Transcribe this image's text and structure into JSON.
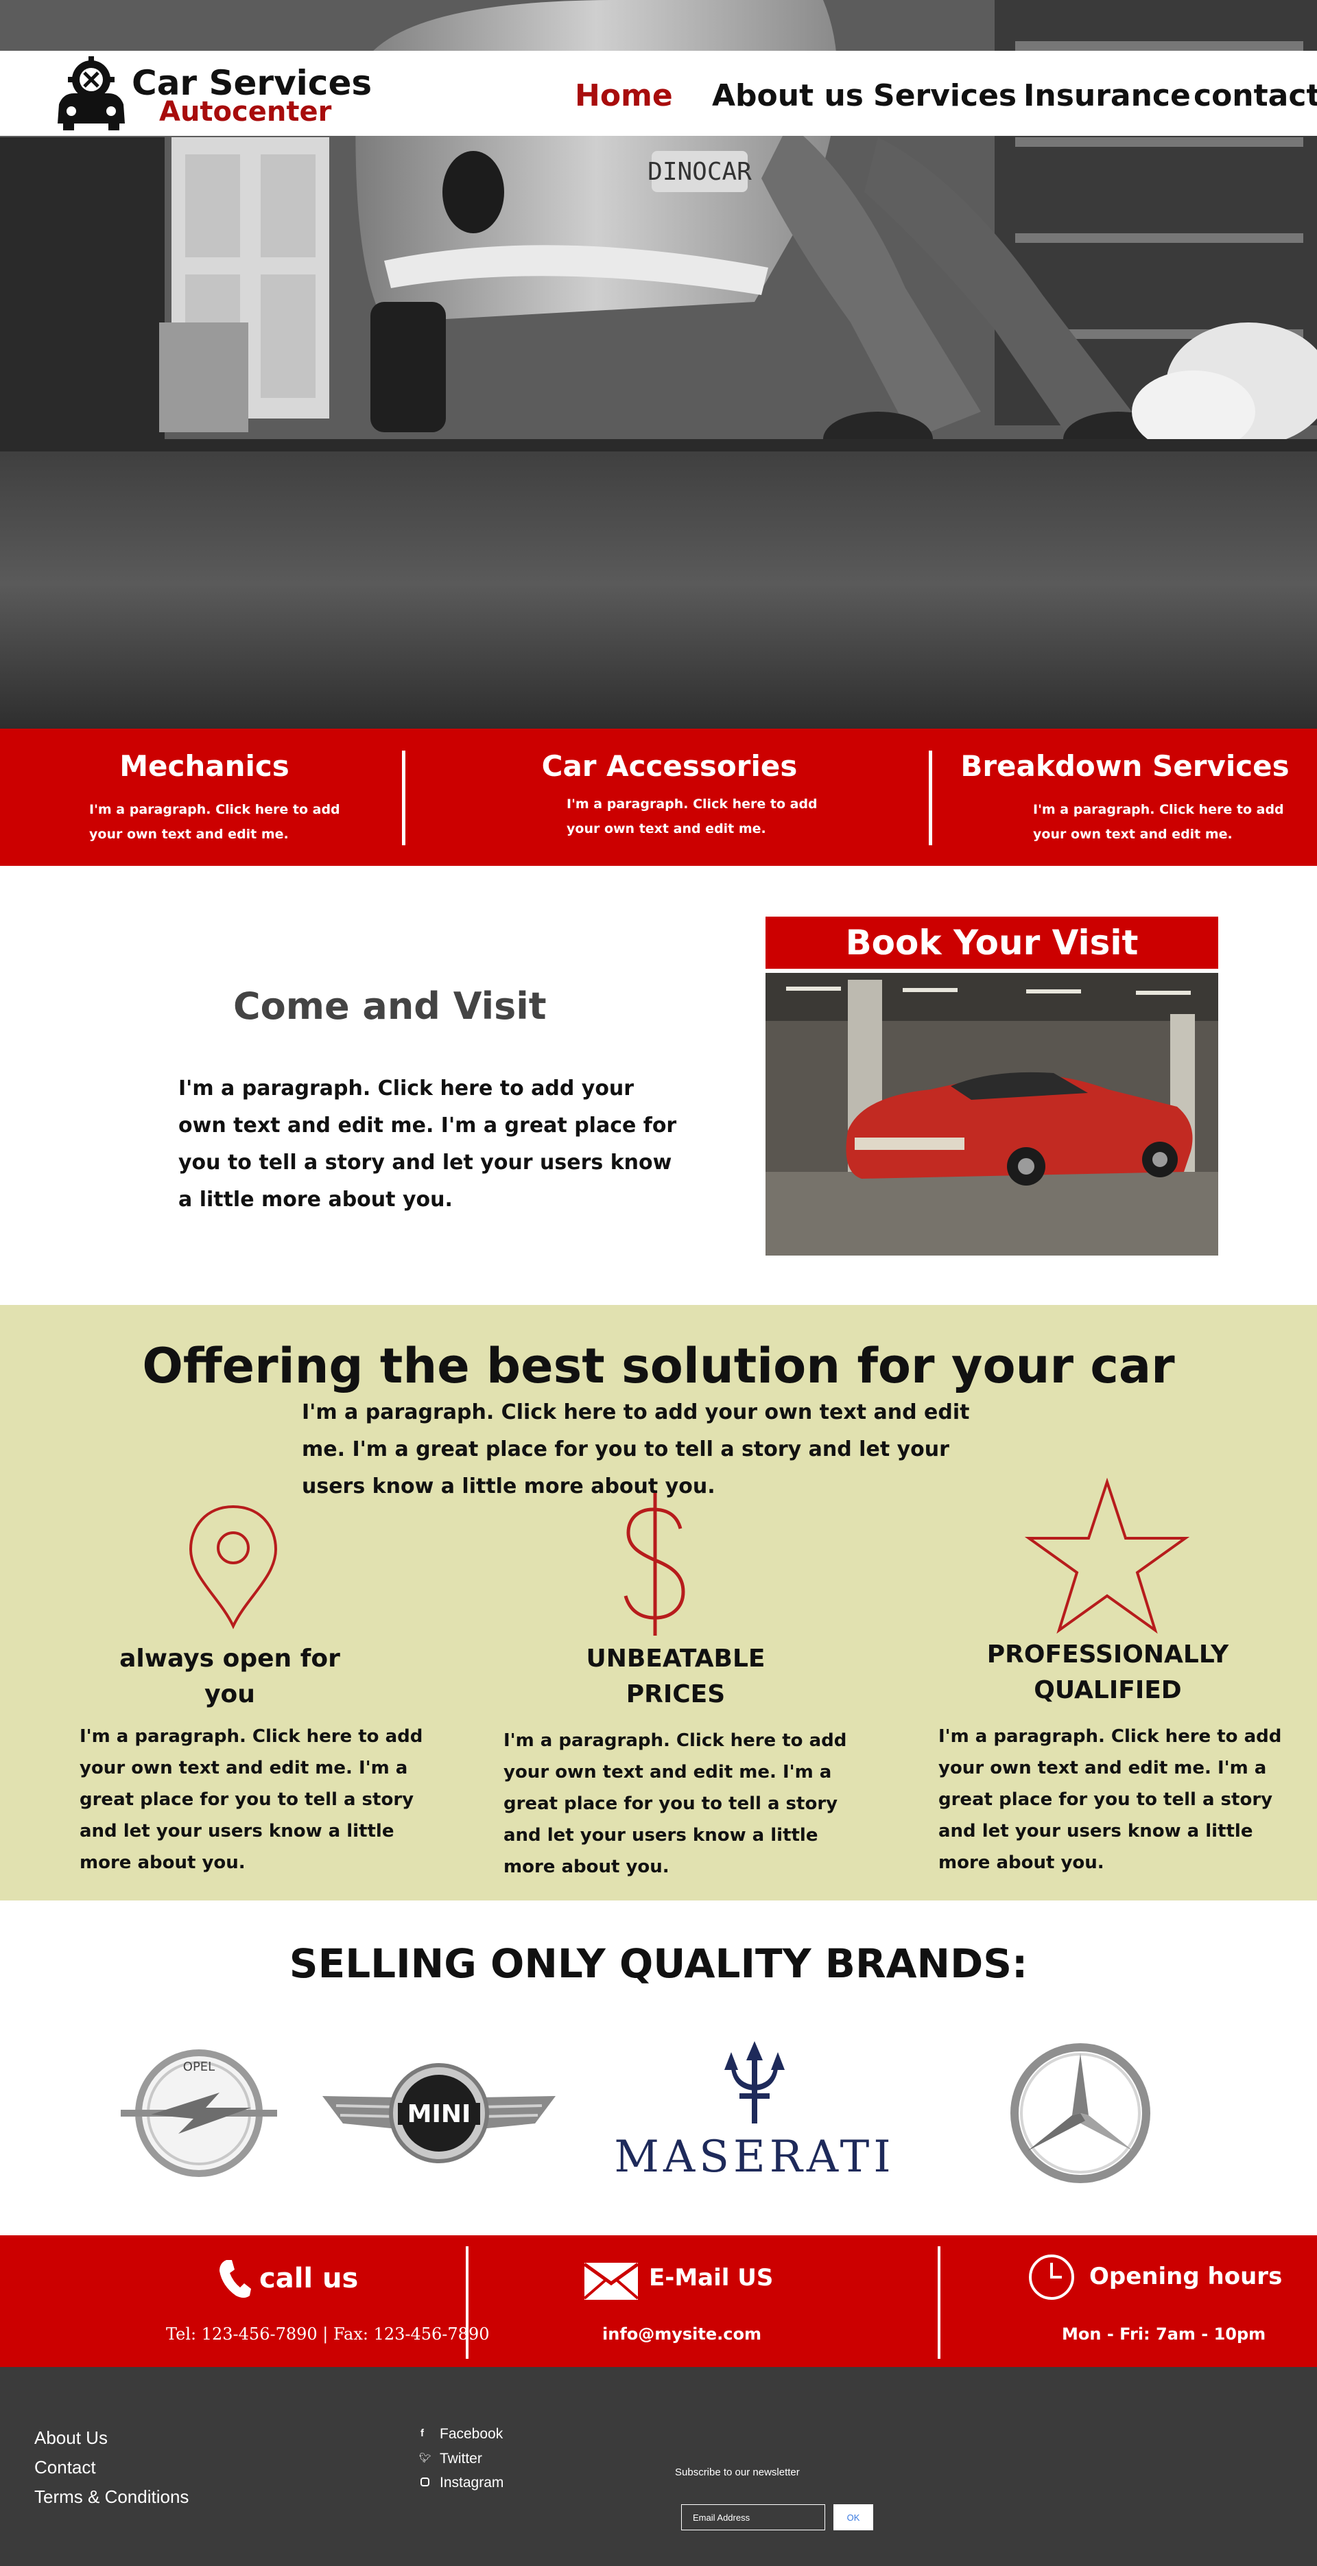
{
  "brand": {
    "title": "Car Services",
    "subtitle": "Autocenter",
    "accent_red": "#cc0000",
    "dark_red": "#a80c0c"
  },
  "nav": {
    "items": [
      {
        "label": "Home",
        "active": true
      },
      {
        "label": "About us",
        "active": false
      },
      {
        "label": "Services",
        "active": false
      },
      {
        "label": "Insurance",
        "active": false
      },
      {
        "label": "contact",
        "active": false
      }
    ]
  },
  "hero": {
    "plate": "DINOCAR",
    "image_description": "black and white mechanic lying under vintage car"
  },
  "features": [
    {
      "title": "Mechanics",
      "text": "I'm a paragraph. Click here to add your own text and edit me."
    },
    {
      "title": "Car Accessories",
      "text": "I'm a paragraph. Click here to add your own text and edit me."
    },
    {
      "title": "Breakdown Services",
      "text": "I'm a paragraph. Click here to add your own text and edit me."
    }
  ],
  "visit": {
    "title": "Come and Visit",
    "text": "I'm a paragraph. Click here to add your own text and edit me. I'm a great place for you to tell a story and let your users know a little more about you.",
    "book_label": "Book Your Visit"
  },
  "offering": {
    "title": "Offering the best solution for your car",
    "intro": "I'm a paragraph. Click here to add your own text and edit me. I'm a great place for you to tell a story and let your users know a little more about you.",
    "bg_color": "#e1e1b0",
    "items": [
      {
        "icon": "location-pin-icon",
        "title": "always open for you",
        "text": "I'm a paragraph. Click here to add your own text and edit me. I'm a great place for you to tell a story and let your users know a little more about you."
      },
      {
        "icon": "dollar-icon",
        "title": "UNBEATABLE PRICES",
        "text": "I'm a paragraph. Click here to add your own text and edit me. I'm a great place for you to tell a story and let your users know a little more about you."
      },
      {
        "icon": "star-icon",
        "title": "PROFESSIONALLY QUALIFIED",
        "text": "I'm a paragraph. Click here to add your own text and edit me. I'm a great place for you to tell a story and let your users know a little more about you."
      }
    ]
  },
  "brands": {
    "title": "SELLING ONLY QUALITY BRANDS:",
    "logos": [
      {
        "name": "opel",
        "text": "OPEL"
      },
      {
        "name": "mini",
        "text": "MINI"
      },
      {
        "name": "maserati",
        "text": "MASERATI"
      },
      {
        "name": "mercedes",
        "text": ""
      }
    ]
  },
  "contact": {
    "call_title": "call us",
    "call_text": "Tel: 123-456-7890 | Fax: 123-456-7890",
    "email_title": "E-Mail US",
    "email_text": "info@mysite.com",
    "hours_title": "Opening hours",
    "hours_text": "Mon - Fri: 7am - 10pm"
  },
  "footer": {
    "links": [
      "About Us",
      "Contact",
      "Terms & Conditions"
    ],
    "social": [
      {
        "icon": "facebook-icon",
        "label": "Facebook"
      },
      {
        "icon": "twitter-icon",
        "label": "Twitter"
      },
      {
        "icon": "instagram-icon",
        "label": "Instagram"
      }
    ],
    "newsletter_label": "Subscribe to our newsletter",
    "email_placeholder": "Email Address",
    "ok_label": "OK",
    "bg_color": "#3b3b3b"
  }
}
